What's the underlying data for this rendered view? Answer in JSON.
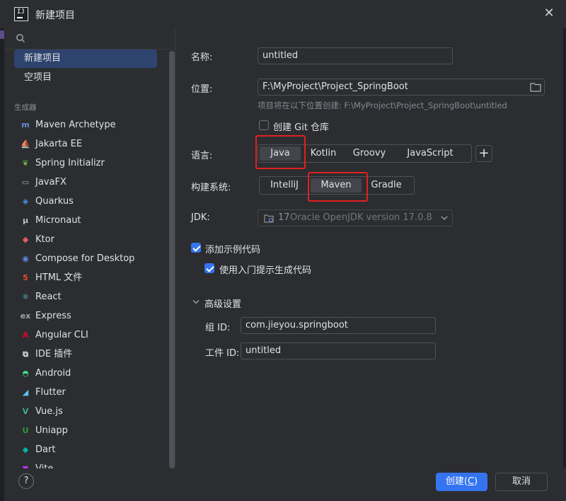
{
  "window": {
    "title": "新建项目"
  },
  "sidebar": {
    "search_placeholder": "",
    "items": [
      {
        "label": "新建项目",
        "selected": true
      },
      {
        "label": "空项目",
        "selected": false
      }
    ],
    "group_label": "生成器",
    "generators": [
      {
        "label": "Maven Archetype",
        "icon": "maven-icon",
        "glyph": "m",
        "color": "#6b8bd6"
      },
      {
        "label": "Jakarta EE",
        "icon": "jakarta-icon",
        "glyph": "⛵",
        "color": "#f0a030"
      },
      {
        "label": "Spring Initializr",
        "icon": "spring-icon",
        "glyph": "❦",
        "color": "#6db33f"
      },
      {
        "label": "JavaFX",
        "icon": "javafx-icon",
        "glyph": "▭",
        "color": "#a0a4ab"
      },
      {
        "label": "Quarkus",
        "icon": "quarkus-icon",
        "glyph": "◈",
        "color": "#4695eb"
      },
      {
        "label": "Micronaut",
        "icon": "micronaut-icon",
        "glyph": "μ",
        "color": "#c0c0c0"
      },
      {
        "label": "Ktor",
        "icon": "ktor-icon",
        "glyph": "◆",
        "color": "#e65c5c"
      },
      {
        "label": "Compose for Desktop",
        "icon": "compose-icon",
        "glyph": "◉",
        "color": "#5f88e8"
      },
      {
        "label": "HTML 文件",
        "icon": "html-icon",
        "glyph": "5",
        "color": "#e44d26"
      },
      {
        "label": "React",
        "icon": "react-icon",
        "glyph": "⚛",
        "color": "#61dafb"
      },
      {
        "label": "Express",
        "icon": "express-icon",
        "glyph": "ex",
        "color": "#a0a4ab"
      },
      {
        "label": "Angular CLI",
        "icon": "angular-icon",
        "glyph": "A",
        "color": "#dd0031"
      },
      {
        "label": "IDE 插件",
        "icon": "plugin-icon",
        "glyph": "⧉",
        "color": "#dfe1e5"
      },
      {
        "label": "Android",
        "icon": "android-icon",
        "glyph": "◓",
        "color": "#3ddc84"
      },
      {
        "label": "Flutter",
        "icon": "flutter-icon",
        "glyph": "◢",
        "color": "#54c5f8"
      },
      {
        "label": "Vue.js",
        "icon": "vue-icon",
        "glyph": "V",
        "color": "#41b883"
      },
      {
        "label": "Uniapp",
        "icon": "uniapp-icon",
        "glyph": "U",
        "color": "#2b9939"
      },
      {
        "label": "Dart",
        "icon": "dart-icon",
        "glyph": "◆",
        "color": "#00b4ab"
      },
      {
        "label": "Vite",
        "icon": "vite-icon",
        "glyph": "▼",
        "color": "#bd34fe"
      }
    ]
  },
  "form": {
    "name_label": "名称:",
    "name_value": "untitled",
    "location_label": "位置:",
    "location_value": "F:\\MyProject\\Project_SpringBoot",
    "location_hint": "项目将在以下位置创建: F:\\MyProject\\Project_SpringBoot\\untitled",
    "git_label": "创建 Git 仓库",
    "git_checked": false,
    "language_label": "语言:",
    "languages": [
      "Java",
      "Kotlin",
      "Groovy",
      "JavaScript"
    ],
    "language_selected": "Java",
    "add_language": "+",
    "build_label": "构建系统:",
    "build_systems": [
      "IntelliJ",
      "Maven",
      "Gradle"
    ],
    "build_selected": "Maven",
    "jdk_label": "JDK:",
    "jdk_version": "17",
    "jdk_name": "Oracle OpenJDK version 17.0.8",
    "sample_label": "添加示例代码",
    "sample_checked": true,
    "onboarding_label": "使用入门提示生成代码",
    "onboarding_checked": true,
    "advanced_label": "高级设置",
    "group_id_label": "组 ID:",
    "group_id_value": "com.jieyou.springboot",
    "artifact_id_label": "工件 ID:",
    "artifact_id_value": "untitled"
  },
  "footer": {
    "help": "?",
    "create_label": "创建(",
    "create_mnemonic": "C",
    "create_suffix": ")",
    "cancel_label": "取消"
  },
  "colors": {
    "accent": "#3574f0",
    "selection": "#2e436e",
    "highlight": "#e02020",
    "background": "#2b2d30"
  }
}
